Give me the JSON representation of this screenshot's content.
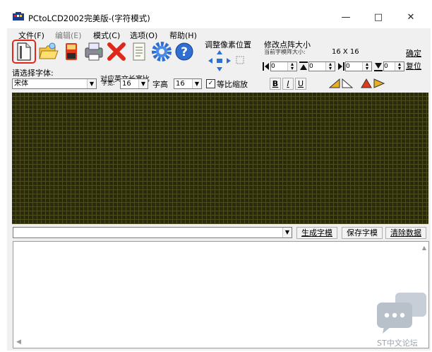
{
  "window": {
    "title": "PCtoLCD2002完美版-(字符模式)",
    "controls": {
      "minimize": "—",
      "maximize": "□",
      "close": "✕"
    }
  },
  "menu": [
    "文件(F)",
    "编辑(E)",
    "模式(C)",
    "选项(O)",
    "帮助(H)"
  ],
  "toolbar": {
    "icons": [
      "new-file-icon",
      "open-folder-icon",
      "save-disk-icon",
      "print-icon",
      "delete-x-icon",
      "document-icon",
      "settings-gear-icon",
      "help-icon"
    ],
    "adjust_label": "调整像素位置",
    "resize_label": "修改点阵大小",
    "current_size_label": "当前字模阵大小:",
    "current_size_value": "16 X 16",
    "confirm_label": "确定",
    "reset_label": "复位",
    "spin_values": [
      "0",
      "0",
      "0",
      "0"
    ]
  },
  "font_row": {
    "select_font_label": "请选择字体:",
    "font_value": "宋体",
    "ratio_label": "对应英文长宽比",
    "width_label": "字宽:",
    "width_value": "16",
    "height_label": "字高",
    "height_value": "16",
    "proportional_label": "等比缩放",
    "proportional_checked": "✓",
    "bold_label": "B",
    "italic_label": "I",
    "underline_label": "U"
  },
  "bottom_bar": {
    "generate_label": "生成字模",
    "save_label": "保存字模",
    "clear_label": "清除数据"
  },
  "watermark": {
    "text": "ST中文论坛"
  },
  "colors": {
    "grid_background": "#2a2a10",
    "grid_lines": "#4d4d1d",
    "highlight_box": "#e0281a"
  }
}
